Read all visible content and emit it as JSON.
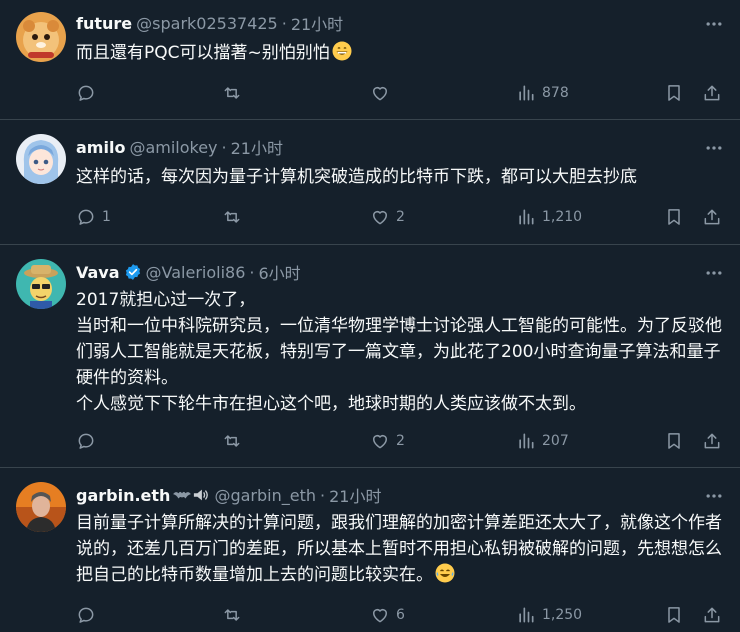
{
  "tweets": [
    {
      "name": "future",
      "handle": "@spark02537425",
      "dot": "·",
      "time": "21小时",
      "text": "而且還有PQC可以擋著~别怕别怕",
      "replies": "",
      "retweets": "",
      "likes": "",
      "views": "878"
    },
    {
      "name": "amilo",
      "handle": "@amilokey",
      "dot": "·",
      "time": "21小时",
      "text": "这样的话，每次因为量子计算机突破造成的比特币下跌，都可以大胆去抄底",
      "replies": "1",
      "retweets": "",
      "likes": "2",
      "views": "1,210"
    },
    {
      "name": "Vava",
      "handle": "@Valerioli86",
      "dot": "·",
      "time": "6小时",
      "text": "2017就担心过一次了，\n当时和一位中科院研究员，一位清华物理学博士讨论强人工智能的可能性。为了反驳他们弱人工智能就是天花板，特别写了一篇文章，为此花了200小时查询量子算法和量子硬件的资料。\n个人感觉下下轮牛市在担心这个吧，地球时期的人类应该做不太到。",
      "replies": "",
      "retweets": "",
      "likes": "2",
      "views": "207"
    },
    {
      "name": "garbin.eth",
      "handle": "@garbin_eth",
      "dot": "·",
      "time": "21小时",
      "text": "目前量子计算所解决的计算问题，跟我们理解的加密计算差距还太大了，就像这个作者说的，还差几百万门的差距，所以基本上暂时不用担心私钥被破解的问题，先想想怎么把自己的比特币数量增加上去的问题比较实在。",
      "replies": "",
      "retweets": "",
      "likes": "6",
      "views": "1,250"
    }
  ],
  "icons": {
    "reply": "reply-icon",
    "retweet": "retweet-icon",
    "like": "heart-icon",
    "views": "views-icon",
    "bookmark": "bookmark-icon",
    "share": "share-icon",
    "more": "more-icon",
    "verified": "verified-badge-icon"
  },
  "colors": {
    "background": "#15202b",
    "text": "#f7f9f9",
    "secondary": "#8b98a5",
    "divider": "#38444d",
    "verified": "#1d9bf0"
  }
}
